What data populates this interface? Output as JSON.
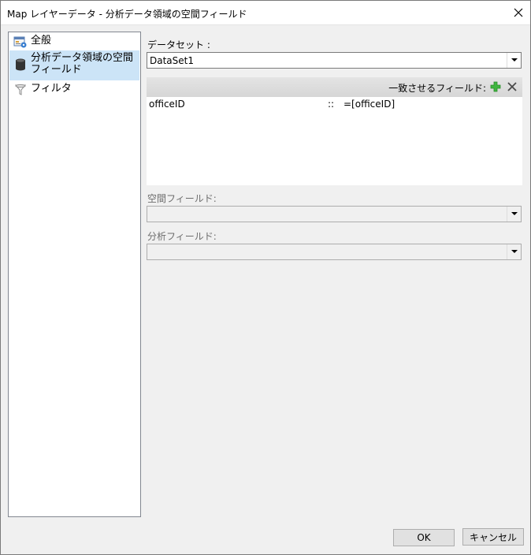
{
  "window": {
    "title": "Map レイヤーデータ - 分析データ領域の空間フィールド"
  },
  "sidebar": {
    "items": [
      {
        "label": "全般",
        "icon": "general-settings-icon"
      },
      {
        "label": "分析データ領域の空間フィールド",
        "icon": "database-icon"
      },
      {
        "label": "フィルタ",
        "icon": "filter-icon"
      }
    ],
    "selected_index": 1
  },
  "dataset": {
    "label": "データセット :",
    "value": "DataSet1"
  },
  "match_fields": {
    "title": "一致させるフィールド:",
    "rows": [
      {
        "left": "officeID",
        "sep": "::",
        "right": "=[officeID]"
      }
    ]
  },
  "spatial_field": {
    "label": "空間フィールド:",
    "value": ""
  },
  "analytical_field": {
    "label": "分析フィールド:",
    "value": ""
  },
  "buttons": {
    "ok": "OK",
    "cancel": "キャンセル"
  },
  "colors": {
    "selection": "#cce4f7",
    "add_icon": "#3fb53f"
  }
}
